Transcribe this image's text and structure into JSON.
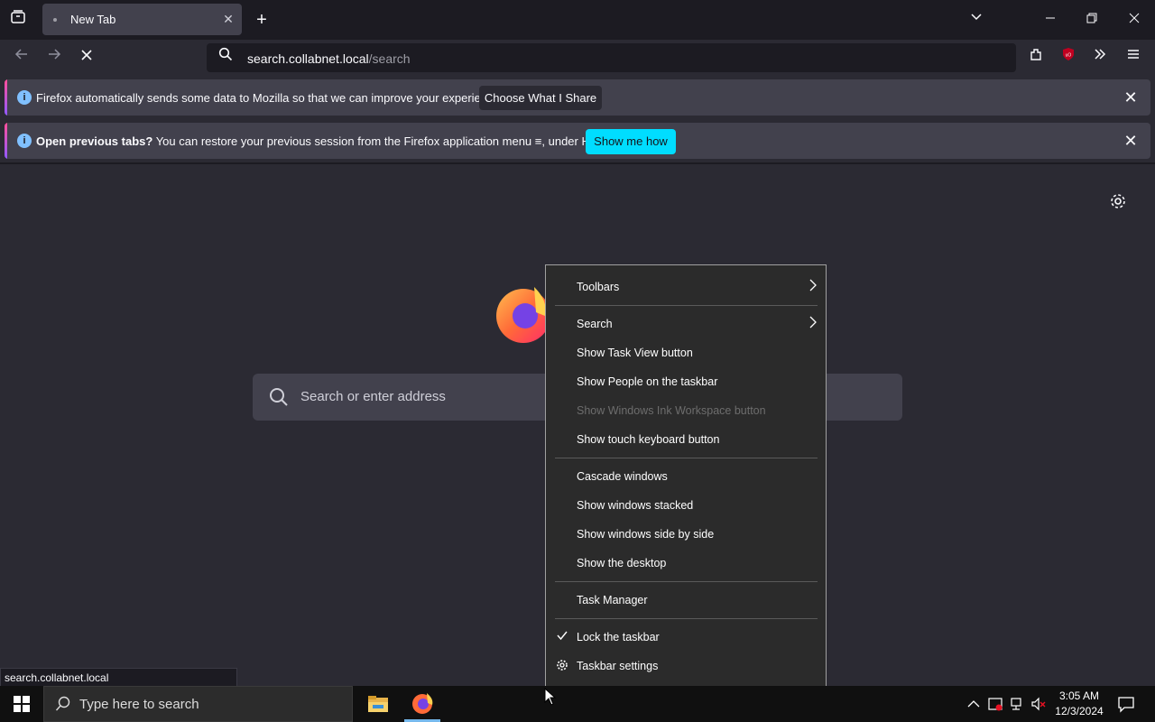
{
  "browser": {
    "tab_title": "New Tab",
    "url_host": "search.collabnet.local",
    "url_path": "/search",
    "status_url": "search.collabnet.local"
  },
  "notifications": {
    "data_msg": "Firefox automatically sends some data to Mozilla so that we can improve your experience.",
    "data_button": "Choose What I Share",
    "session_msg_bold": "Open previous tabs?",
    "session_msg": "You can restore your previous session from the Firefox application menu",
    "session_msg_tail": ", under History.",
    "session_button": "Show me how"
  },
  "newtab": {
    "search_placeholder": "Search or enter address"
  },
  "context_menu": {
    "toolbars": "Toolbars",
    "search": "Search",
    "task_view": "Show Task View button",
    "people": "Show People on the taskbar",
    "ink": "Show Windows Ink Workspace button",
    "touch_keyboard": "Show touch keyboard button",
    "cascade": "Cascade windows",
    "stacked": "Show windows stacked",
    "side_by_side": "Show windows side by side",
    "desktop": "Show the desktop",
    "task_manager": "Task Manager",
    "lock": "Lock the taskbar",
    "settings": "Taskbar settings"
  },
  "taskbar": {
    "search_placeholder": "Type here to search",
    "time": "3:05 AM",
    "date": "12/3/2024"
  },
  "colors": {
    "accent_cyan": "#00ddff",
    "info_blue": "#80c0ff",
    "firefox_purple": "#9059ff"
  },
  "icons": [
    "tab-list-icon",
    "close-icon",
    "plus-icon",
    "chevron-down-icon",
    "minimize-icon",
    "restore-icon",
    "back-icon",
    "forward-icon",
    "stop-icon",
    "search-icon",
    "extensions-icon",
    "ublock-icon",
    "overflow-icon",
    "menu-icon",
    "info-icon",
    "gear-icon",
    "firefox-logo",
    "chevron-right-icon",
    "check-icon",
    "windows-start-icon",
    "file-explorer-icon",
    "notification-icon"
  ]
}
